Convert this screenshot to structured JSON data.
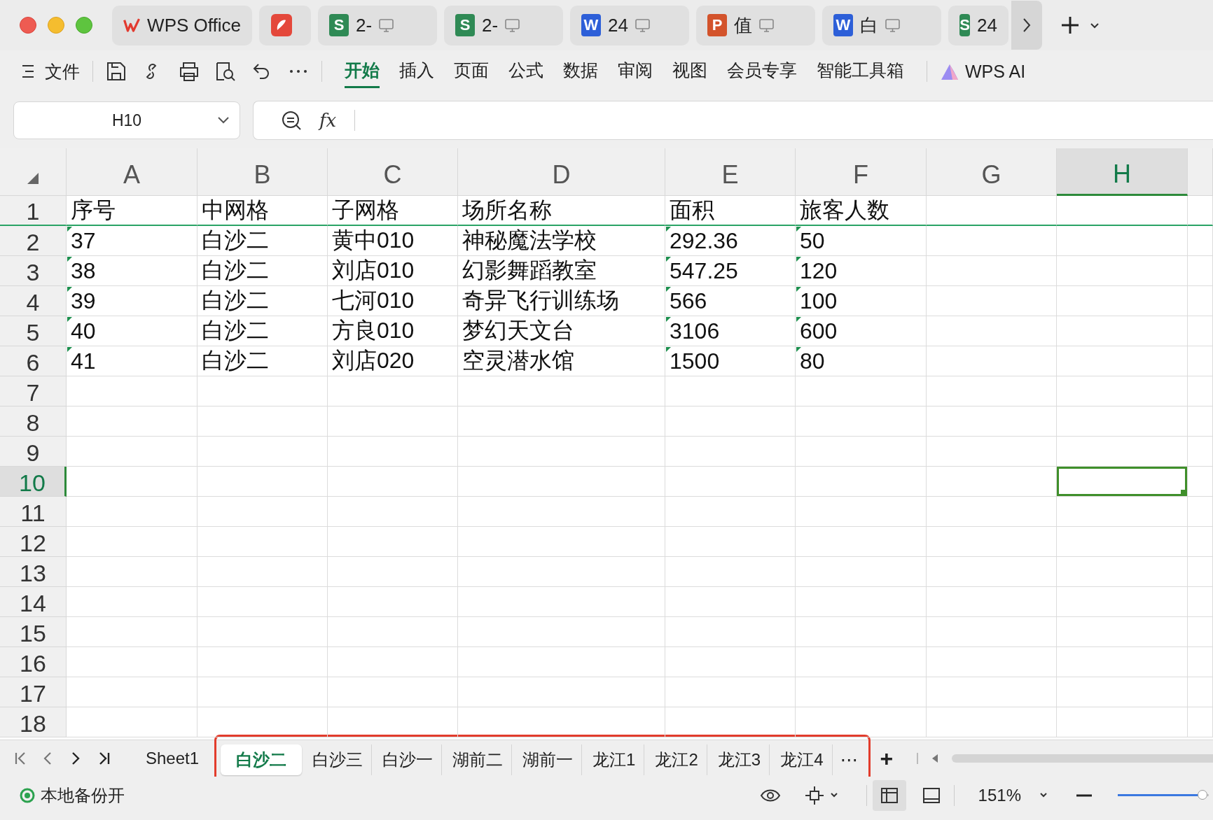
{
  "doc_tabs": [
    {
      "kind": "home",
      "label": "WPS Office"
    },
    {
      "kind": "pdf"
    },
    {
      "kind": "sheet",
      "badge": "S",
      "label": "2-"
    },
    {
      "kind": "sheet",
      "badge": "S",
      "label": "2-"
    },
    {
      "kind": "writer",
      "badge": "W",
      "label": "24"
    },
    {
      "kind": "slides",
      "badge": "P",
      "label": "值"
    },
    {
      "kind": "writer",
      "badge": "W",
      "label": "白"
    },
    {
      "kind": "sheet",
      "badge": "S",
      "label": "24"
    }
  ],
  "menu": {
    "file": "文件",
    "tabs": [
      {
        "label": "开始",
        "selected": true
      },
      {
        "label": "插入",
        "selected": false
      },
      {
        "label": "页面",
        "selected": false
      },
      {
        "label": "公式",
        "selected": false
      },
      {
        "label": "数据",
        "selected": false
      },
      {
        "label": "审阅",
        "selected": false
      },
      {
        "label": "视图",
        "selected": false
      },
      {
        "label": "会员专享",
        "selected": false
      },
      {
        "label": "智能工具箱",
        "selected": false
      }
    ],
    "ai": "WPS AI"
  },
  "name_box": "H10",
  "formula_label": "fx",
  "columns": [
    {
      "label": "A",
      "selected": false
    },
    {
      "label": "B",
      "selected": false
    },
    {
      "label": "C",
      "selected": false
    },
    {
      "label": "D",
      "selected": false
    },
    {
      "label": "E",
      "selected": false
    },
    {
      "label": "F",
      "selected": false
    },
    {
      "label": "G",
      "selected": false
    },
    {
      "label": "H",
      "selected": true
    }
  ],
  "rows": [
    {
      "number": "1",
      "selected": false,
      "frozen": true,
      "cells": [
        {
          "text": "序号",
          "flag": false
        },
        {
          "text": "中网格",
          "flag": false
        },
        {
          "text": "子网格",
          "flag": false
        },
        {
          "text": "场所名称",
          "flag": false
        },
        {
          "text": "面积",
          "flag": false
        },
        {
          "text": "旅客人数",
          "flag": false
        }
      ]
    },
    {
      "number": "2",
      "selected": false,
      "frozen": false,
      "cells": [
        {
          "text": "37",
          "flag": true
        },
        {
          "text": "白沙二",
          "flag": false
        },
        {
          "text": "黄中010",
          "flag": false
        },
        {
          "text": "神秘魔法学校",
          "flag": false
        },
        {
          "text": "292.36",
          "flag": true
        },
        {
          "text": "50",
          "flag": true
        }
      ]
    },
    {
      "number": "3",
      "selected": false,
      "frozen": false,
      "cells": [
        {
          "text": "38",
          "flag": true
        },
        {
          "text": "白沙二",
          "flag": false
        },
        {
          "text": "刘店010",
          "flag": false
        },
        {
          "text": "幻影舞蹈教室",
          "flag": false
        },
        {
          "text": "547.25",
          "flag": true
        },
        {
          "text": "120",
          "flag": true
        }
      ]
    },
    {
      "number": "4",
      "selected": false,
      "frozen": false,
      "cells": [
        {
          "text": "39",
          "flag": true
        },
        {
          "text": "白沙二",
          "flag": false
        },
        {
          "text": "七河010",
          "flag": false
        },
        {
          "text": "奇异飞行训练场",
          "flag": false
        },
        {
          "text": "566",
          "flag": true
        },
        {
          "text": "100",
          "flag": true
        }
      ]
    },
    {
      "number": "5",
      "selected": false,
      "frozen": false,
      "cells": [
        {
          "text": "40",
          "flag": true
        },
        {
          "text": "白沙二",
          "flag": false
        },
        {
          "text": "方良010",
          "flag": false
        },
        {
          "text": "梦幻天文台",
          "flag": false
        },
        {
          "text": "3106",
          "flag": true
        },
        {
          "text": "600",
          "flag": true
        }
      ]
    },
    {
      "number": "6",
      "selected": false,
      "frozen": false,
      "cells": [
        {
          "text": "41",
          "flag": true
        },
        {
          "text": "白沙二",
          "flag": false
        },
        {
          "text": "刘店020",
          "flag": false
        },
        {
          "text": "空灵潜水馆",
          "flag": false
        },
        {
          "text": "1500",
          "flag": true
        },
        {
          "text": "80",
          "flag": true
        }
      ]
    },
    {
      "number": "7",
      "selected": false,
      "frozen": false
    },
    {
      "number": "8",
      "selected": false,
      "frozen": false
    },
    {
      "number": "9",
      "selected": false,
      "frozen": false
    },
    {
      "number": "10",
      "selected": true,
      "frozen": false
    },
    {
      "number": "11",
      "selected": false,
      "frozen": false
    },
    {
      "number": "12",
      "selected": false,
      "frozen": false
    },
    {
      "number": "13",
      "selected": false,
      "frozen": false
    },
    {
      "number": "14",
      "selected": false,
      "frozen": false
    },
    {
      "number": "15",
      "selected": false,
      "frozen": false
    },
    {
      "number": "16",
      "selected": false,
      "frozen": false
    },
    {
      "number": "17",
      "selected": false,
      "frozen": false
    },
    {
      "number": "18",
      "selected": false,
      "frozen": false
    }
  ],
  "sheet_tabs": [
    {
      "label": "Sheet1",
      "selected": false,
      "highlighted": false
    },
    {
      "label": "白沙二",
      "selected": true,
      "highlighted": true
    },
    {
      "label": "白沙三",
      "selected": false,
      "highlighted": true
    },
    {
      "label": "白沙一",
      "selected": false,
      "highlighted": true
    },
    {
      "label": "湖前二",
      "selected": false,
      "highlighted": true
    },
    {
      "label": "湖前一",
      "selected": false,
      "highlighted": true
    },
    {
      "label": "龙江1",
      "selected": false,
      "highlighted": true
    },
    {
      "label": "龙江2",
      "selected": false,
      "highlighted": true
    },
    {
      "label": "龙江3",
      "selected": false,
      "highlighted": true
    },
    {
      "label": "龙江4",
      "selected": false,
      "highlighted": true
    }
  ],
  "sheet_more": "⋯",
  "sheet_add": "+",
  "status": {
    "backup": "本地备份开",
    "views": [
      {
        "kind": "normal",
        "selected": true
      },
      {
        "kind": "page",
        "selected": false
      }
    ],
    "zoom": "151%",
    "zoom_slider": {
      "level": 0.93
    }
  }
}
